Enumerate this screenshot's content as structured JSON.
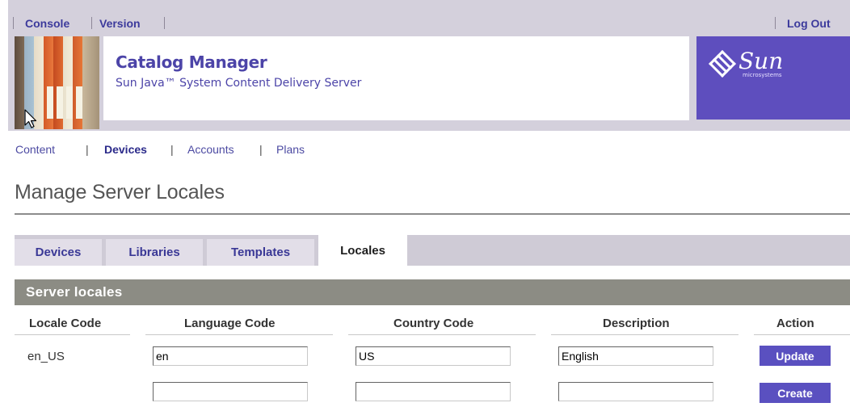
{
  "topnav": {
    "console": "Console",
    "version": "Version",
    "logout": "Log Out"
  },
  "app": {
    "title": "Catalog Manager",
    "subtitle": "Sun Java™ System Content Delivery Server"
  },
  "brand": {
    "name": "Sun",
    "tagline": "microsystems",
    "color": "#5e4ebe"
  },
  "nav": {
    "items": [
      "Content",
      "Devices",
      "Accounts",
      "Plans"
    ],
    "active": "Devices"
  },
  "page": {
    "title": "Manage Server Locales"
  },
  "tabs": [
    {
      "label": "Devices",
      "selected": false
    },
    {
      "label": "Libraries",
      "selected": false
    },
    {
      "label": "Templates",
      "selected": false
    },
    {
      "label": "Locales",
      "selected": true
    }
  ],
  "section": {
    "title": "Server locales"
  },
  "table": {
    "columns": [
      "Locale Code",
      "Language Code",
      "Country Code",
      "Description",
      "Action"
    ],
    "rows": [
      {
        "locale": "en_US",
        "language": "en",
        "country": "US",
        "description": "English",
        "action": "Update"
      },
      {
        "locale": "",
        "language": "",
        "country": "",
        "description": "",
        "action": "Create"
      }
    ]
  },
  "colors": {
    "accent": "#5a50c0",
    "link": "#3c3a9c",
    "section": "#8c8c84"
  }
}
